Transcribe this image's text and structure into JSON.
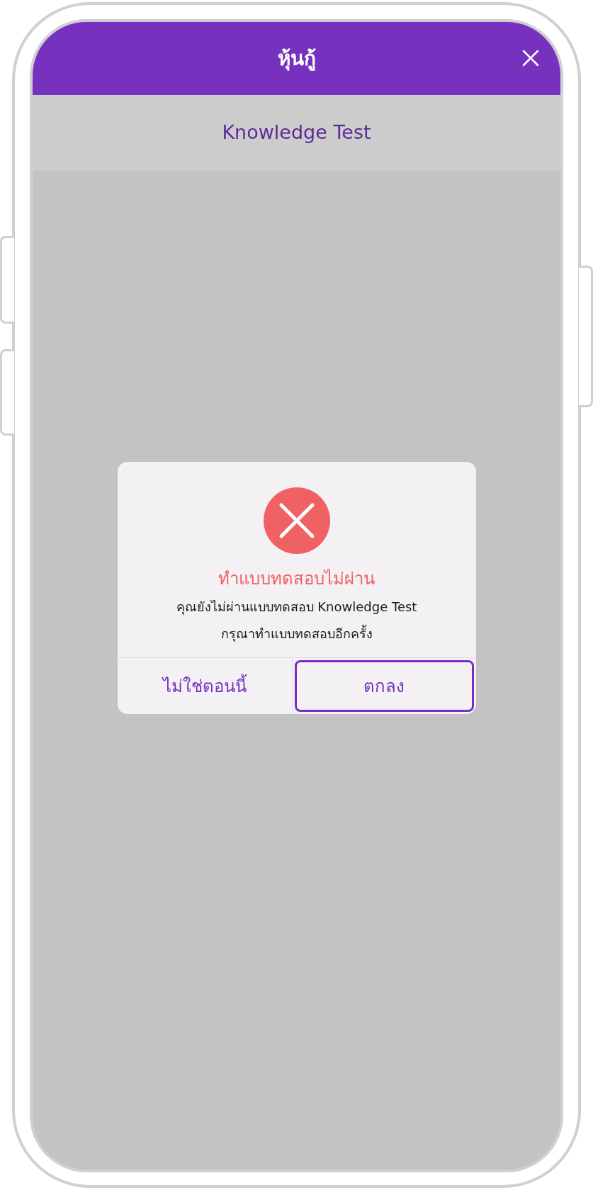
{
  "header": {
    "title": "หุ้นกู้"
  },
  "subheader": {
    "title": "Knowledge Test"
  },
  "dialog": {
    "title": "ทำแบบทดสอบไม่ผ่าน",
    "message_lines": [
      "คุณยังไม่ผ่านแบบทดสอบ Knowledge Test",
      "กรุณาทำแบบทดสอบอีกครั้ง"
    ],
    "buttons": [
      {
        "label": "ไม่ใช่ตอนนี้",
        "selected": false
      },
      {
        "label": "ตกลง",
        "selected": true
      }
    ]
  }
}
